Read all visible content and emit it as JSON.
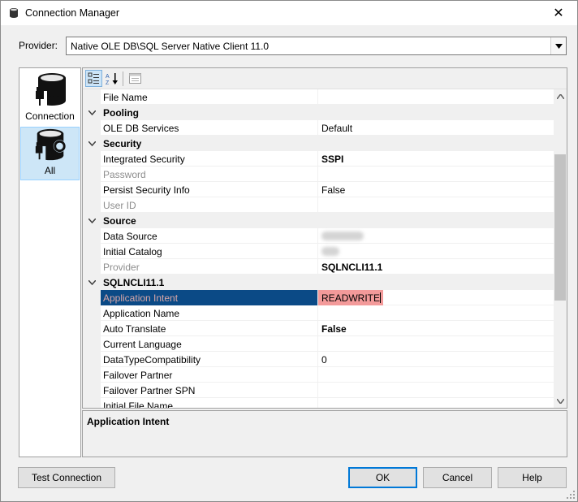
{
  "window": {
    "title": "Connection Manager",
    "close_glyph": "✕"
  },
  "provider": {
    "label": "Provider:",
    "value": "Native OLE DB\\SQL Server Native Client 11.0",
    "arrow_glyph": "▼"
  },
  "sidebar": {
    "items": [
      {
        "label": "Connection",
        "icon": "database-plug-icon",
        "selected": false
      },
      {
        "label": "All",
        "icon": "database-wrench-icon",
        "selected": true
      }
    ]
  },
  "toolbar": {
    "buttons": [
      {
        "name": "categorized-view-button",
        "icon": "categorized-icon",
        "active": true
      },
      {
        "name": "alphabetical-sort-button",
        "icon": "sort-az-icon",
        "active": false
      },
      {
        "name": "property-pages-button",
        "icon": "property-pages-icon",
        "active": false
      }
    ]
  },
  "property_grid": {
    "rows": [
      {
        "kind": "prop",
        "name": "File Name",
        "value": ""
      },
      {
        "kind": "cat",
        "name": "Pooling",
        "toggle": "−"
      },
      {
        "kind": "prop",
        "name": "OLE DB Services",
        "value": "Default"
      },
      {
        "kind": "cat",
        "name": "Security",
        "toggle": "−"
      },
      {
        "kind": "prop",
        "name": "Integrated Security",
        "value": "SSPI",
        "bold": true
      },
      {
        "kind": "prop",
        "name": "Password",
        "value": "",
        "disabled": true
      },
      {
        "kind": "prop",
        "name": "Persist Security Info",
        "value": "False"
      },
      {
        "kind": "prop",
        "name": "User ID",
        "value": "",
        "disabled": true
      },
      {
        "kind": "cat",
        "name": "Source",
        "toggle": "−"
      },
      {
        "kind": "prop",
        "name": "Data Source",
        "value": "",
        "blurred": true
      },
      {
        "kind": "prop",
        "name": "Initial Catalog",
        "value": "",
        "blurred": true
      },
      {
        "kind": "prop",
        "name": "Provider",
        "value": "SQLNCLI11.1",
        "bold": true,
        "disabled": true
      },
      {
        "kind": "cat",
        "name": "SQLNCLI11.1",
        "toggle": "−"
      },
      {
        "kind": "prop",
        "name": "Application Intent",
        "value": "READWRITE",
        "selected": true
      },
      {
        "kind": "prop",
        "name": "Application Name",
        "value": ""
      },
      {
        "kind": "prop",
        "name": "Auto Translate",
        "value": "False",
        "bold": true
      },
      {
        "kind": "prop",
        "name": "Current Language",
        "value": ""
      },
      {
        "kind": "prop",
        "name": "DataTypeCompatibility",
        "value": "0"
      },
      {
        "kind": "prop",
        "name": "Failover Partner",
        "value": ""
      },
      {
        "kind": "prop",
        "name": "Failover Partner SPN",
        "value": ""
      },
      {
        "kind": "prop",
        "name": "Initial File Name",
        "value": ""
      }
    ]
  },
  "scrollbar": {
    "up_glyph": "▲",
    "down_glyph": "▼"
  },
  "description": {
    "title": "Application Intent"
  },
  "buttons": {
    "test_connection": "Test Connection",
    "ok": "OK",
    "cancel": "Cancel",
    "help": "Help"
  },
  "colors": {
    "selection": "#0b4a86",
    "edit_highlight": "#f39a9a",
    "sidebar_selected": "#cde6f7"
  }
}
